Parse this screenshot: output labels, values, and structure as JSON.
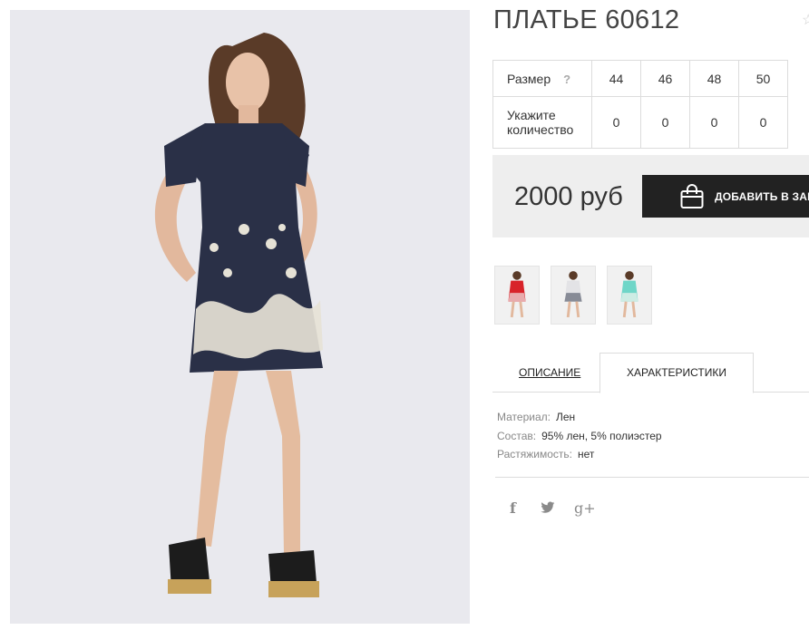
{
  "product": {
    "title": "ПЛАТЬЕ 60612"
  },
  "sizes": {
    "size_label": "Размер",
    "help_icon": "?",
    "values": [
      "44",
      "46",
      "48",
      "50"
    ],
    "quantity_label_line1": "Укажите",
    "quantity_label_line2": "количество",
    "quantities": [
      "0",
      "0",
      "0",
      "0"
    ]
  },
  "purchase": {
    "price": "2000 руб",
    "add_to_cart_label": "ДОБАВИТЬ В ЗАКАЗ"
  },
  "thumbnails": [
    {
      "name": "red",
      "color": "#d8232a"
    },
    {
      "name": "white",
      "color": "#e8e8ea"
    },
    {
      "name": "mint",
      "color": "#6fd6c8"
    }
  ],
  "tabs": {
    "description": "ОПИСАНИЕ",
    "specs": "ХАРАКТЕРИСТИКИ"
  },
  "specs": [
    {
      "key": "Материал:",
      "value": "Лен"
    },
    {
      "key": "Состав:",
      "value": "95% лен, 5% полиэстер"
    },
    {
      "key": "Растяжимость:",
      "value": "нет"
    }
  ],
  "social": {
    "facebook_glyph": "f",
    "twitter_glyph": "🐦",
    "googleplus_glyph": "g+"
  },
  "colors": {
    "dress_navy": "#2a3047",
    "embroidery": "#e6e2d6",
    "button_bg": "#222222",
    "price_bg": "#eeeeee"
  }
}
